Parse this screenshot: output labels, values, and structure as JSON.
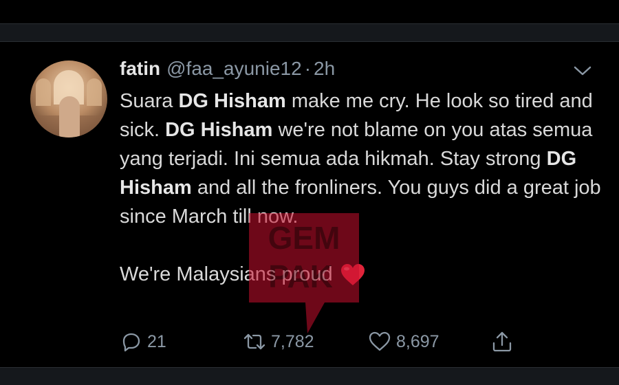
{
  "tweet": {
    "author_name": "fatin",
    "handle": "@faa_ayunie12",
    "separator": "·",
    "time": "2h",
    "text": {
      "p1_a": "Suara ",
      "p1_b": "DG Hisham",
      "p1_c": " make me cry. He look so tired and sick. ",
      "p1_d": "DG Hisham",
      "p1_e": " we're not blame on you atas semua yang terjadi. Ini semua ada hikmah. Stay strong ",
      "p1_f": "DG Hisham",
      "p1_g": " and all the fronliners. You guys did a great job since March till now.",
      "p2": "We're Malaysians proud"
    }
  },
  "actions": {
    "replies": "21",
    "retweets": "7,782",
    "likes": "8,697"
  },
  "watermark": {
    "line1": "GEM",
    "line2": "PAK"
  },
  "colors": {
    "background": "#000000",
    "text": "#d9d9d9",
    "muted": "#8b98a5",
    "emoji_heart": "#e0243a",
    "watermark": "#c8102e"
  }
}
